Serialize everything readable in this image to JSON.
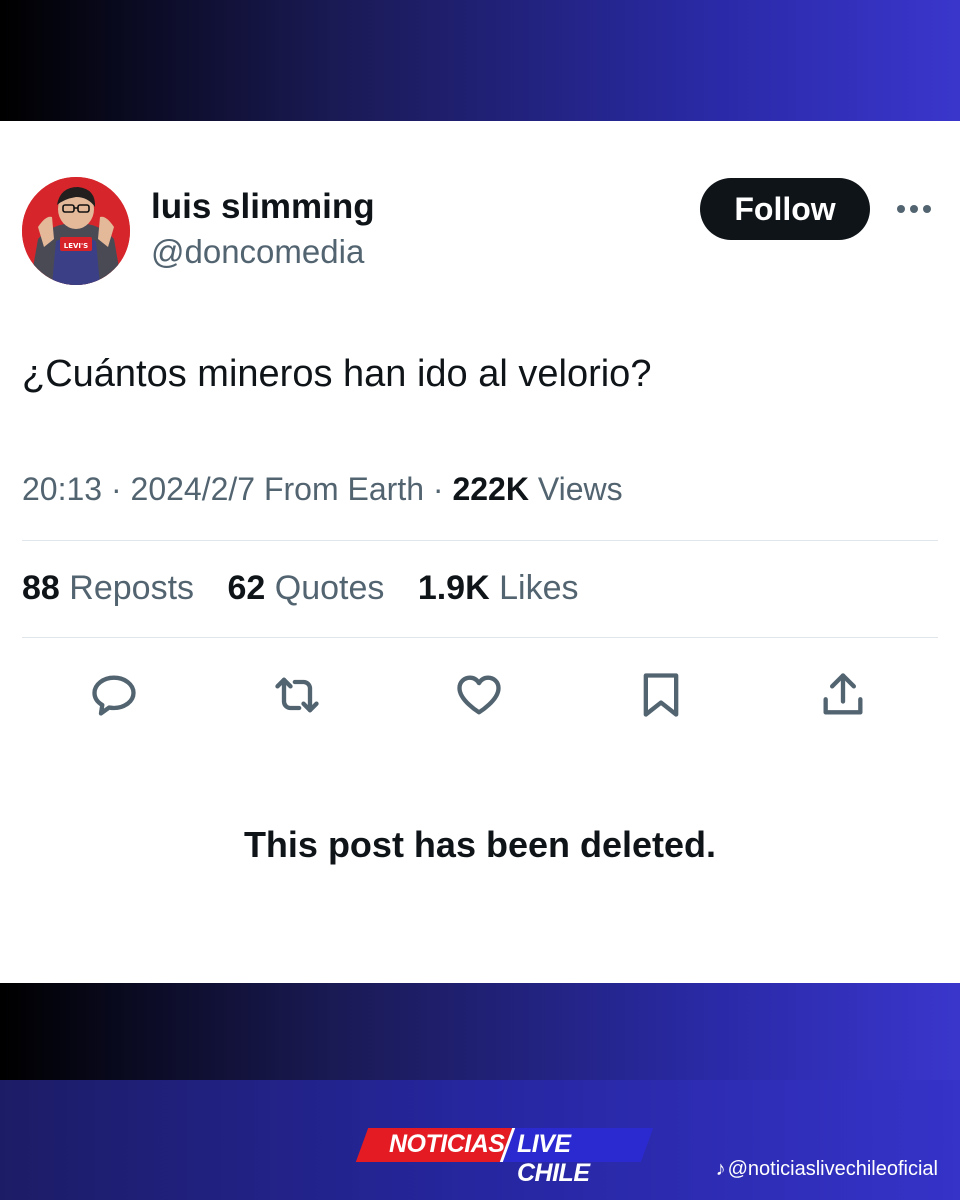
{
  "tweet": {
    "author_name": "luis slimming",
    "handle": "@doncomedia",
    "follow_label": "Follow",
    "text": "¿Cuántos mineros han ido al velorio?",
    "time": "20:13",
    "date": "2024/2/7",
    "source": "From Earth",
    "views_count": "222K",
    "views_label": "Views",
    "separator": "·",
    "reposts_count": "88",
    "reposts_label": "Reposts",
    "quotes_count": "62",
    "quotes_label": "Quotes",
    "likes_count": "1.9K",
    "likes_label": "Likes",
    "deleted_notice": "This post has been deleted.",
    "avatar_shirt_text": "Levi's"
  },
  "actions": {
    "icons": [
      "reply-icon",
      "repost-icon",
      "like-icon",
      "bookmark-icon",
      "share-icon"
    ]
  },
  "footer": {
    "logo_part1": "NOTICIAS",
    "logo_part2": "LIVE CHILE",
    "tiktok_handle": "@noticiaslivechileoficial"
  },
  "colors": {
    "text_primary": "#0f1419",
    "text_secondary": "#536471",
    "logo_red": "#e41b23",
    "logo_blue": "#2b2ad1"
  }
}
